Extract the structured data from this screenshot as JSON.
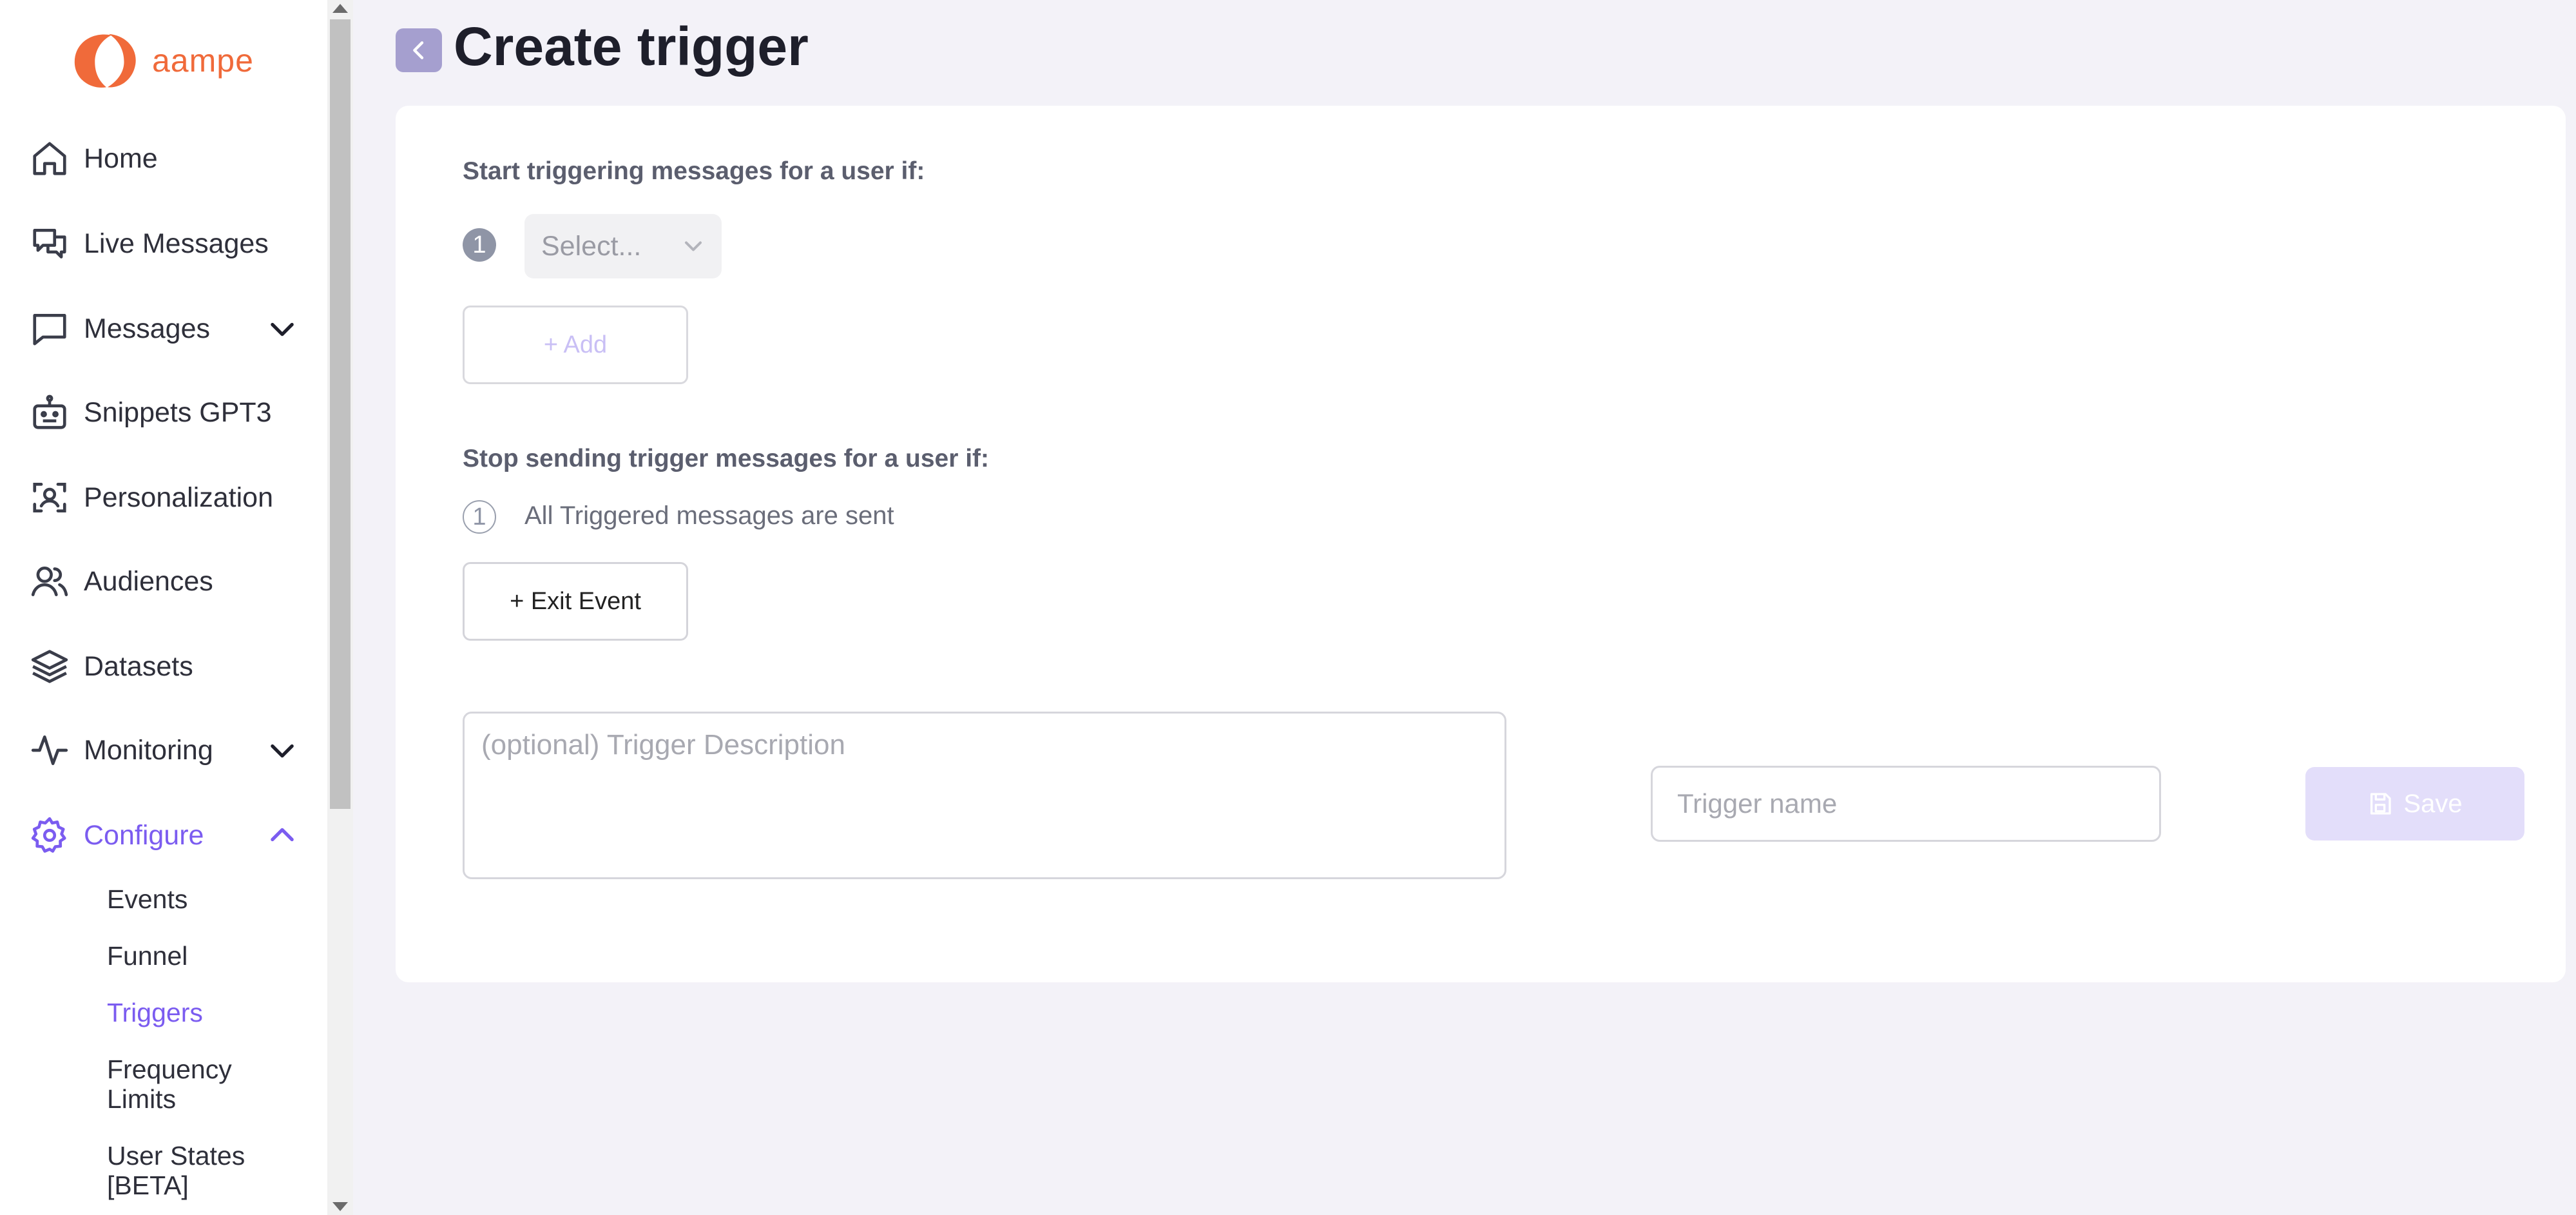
{
  "brand": {
    "name": "aampe",
    "logo_icon": "aampe-logo-icon",
    "brand_color": "#f06a3a",
    "accent_color": "#7b5cf0"
  },
  "sidebar": {
    "items": [
      {
        "label": "Home",
        "icon": "home-icon"
      },
      {
        "label": "Live Messages",
        "icon": "chat-bubbles-icon"
      },
      {
        "label": "Messages",
        "icon": "message-square-icon",
        "expandable": true
      },
      {
        "label": "Snippets GPT3",
        "icon": "robot-icon"
      },
      {
        "label": "Personalization",
        "icon": "person-scan-icon"
      },
      {
        "label": "Audiences",
        "icon": "users-icon"
      },
      {
        "label": "Datasets",
        "icon": "layers-icon"
      },
      {
        "label": "Monitoring",
        "icon": "activity-icon",
        "expandable": true
      },
      {
        "label": "Configure",
        "icon": "gear-icon",
        "expandable": true,
        "expanded": true,
        "active": true
      }
    ],
    "configure_subitems": [
      {
        "label": "Events"
      },
      {
        "label": "Funnel"
      },
      {
        "label": "Triggers",
        "active": true
      },
      {
        "label": "Frequency Limits"
      },
      {
        "label": "User States [BETA]"
      }
    ]
  },
  "header": {
    "title": "Create trigger",
    "back_icon": "chevron-left-icon"
  },
  "start_section": {
    "heading": "Start triggering messages for a user if:",
    "step_number": "1",
    "select_value": "Select...",
    "add_label": "+ Add"
  },
  "stop_section": {
    "heading": "Stop sending trigger messages for a user if:",
    "step_number": "1",
    "condition_text": "All Triggered messages are sent",
    "exit_event_label": "+ Exit Event"
  },
  "form": {
    "description_placeholder": "(optional) Trigger Description",
    "description_value": "",
    "name_placeholder": "Trigger name",
    "name_value": "",
    "save_label": "Save",
    "save_icon": "floppy-disk-icon"
  }
}
